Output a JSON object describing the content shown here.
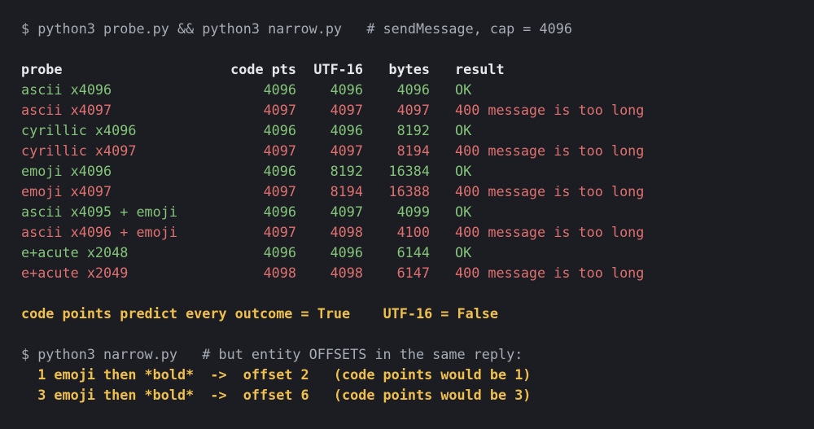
{
  "command1": {
    "prompt": "$ python3 probe.py && python3 narrow.py",
    "comment": "# sendMessage, cap = 4096"
  },
  "table": {
    "headers": {
      "probe": "probe",
      "code_pts": "code pts",
      "utf16": "UTF-16",
      "bytes": "bytes",
      "result": "result"
    },
    "rows": [
      {
        "probe": "ascii x4096",
        "code_pts": "4096",
        "utf16": "4096",
        "bytes": "4096",
        "result": "OK",
        "status": "ok"
      },
      {
        "probe": "ascii x4097",
        "code_pts": "4097",
        "utf16": "4097",
        "bytes": "4097",
        "result": "400 message is too long",
        "status": "err"
      },
      {
        "probe": "cyrillic x4096",
        "code_pts": "4096",
        "utf16": "4096",
        "bytes": "8192",
        "result": "OK",
        "status": "ok"
      },
      {
        "probe": "cyrillic x4097",
        "code_pts": "4097",
        "utf16": "4097",
        "bytes": "8194",
        "result": "400 message is too long",
        "status": "err"
      },
      {
        "probe": "emoji x4096",
        "code_pts": "4096",
        "utf16": "8192",
        "bytes": "16384",
        "result": "OK",
        "status": "ok"
      },
      {
        "probe": "emoji x4097",
        "code_pts": "4097",
        "utf16": "8194",
        "bytes": "16388",
        "result": "400 message is too long",
        "status": "err"
      },
      {
        "probe": "ascii x4095 + emoji",
        "code_pts": "4096",
        "utf16": "4097",
        "bytes": "4099",
        "result": "OK",
        "status": "ok"
      },
      {
        "probe": "ascii x4096 + emoji",
        "code_pts": "4097",
        "utf16": "4098",
        "bytes": "4100",
        "result": "400 message is too long",
        "status": "err"
      },
      {
        "probe": "e+acute x2048",
        "code_pts": "4096",
        "utf16": "4096",
        "bytes": "6144",
        "result": "OK",
        "status": "ok"
      },
      {
        "probe": "e+acute x2049",
        "code_pts": "4098",
        "utf16": "4098",
        "bytes": "6147",
        "result": "400 message is too long",
        "status": "err"
      }
    ]
  },
  "summary": {
    "left": "code points predict every outcome = True",
    "right": "UTF-16 = False"
  },
  "command2": {
    "prompt": "$ python3 narrow.py",
    "comment": "# but entity OFFSETS in the same reply:"
  },
  "offsets": [
    "1 emoji then *bold*  ->  offset 2   (code points would be 1)",
    "3 emoji then *bold*  ->  offset 6   (code points would be 3)"
  ],
  "colors": {
    "background": "#1b1d22",
    "ok": "#84c47a",
    "error": "#e07070",
    "highlight": "#f0c04e"
  }
}
